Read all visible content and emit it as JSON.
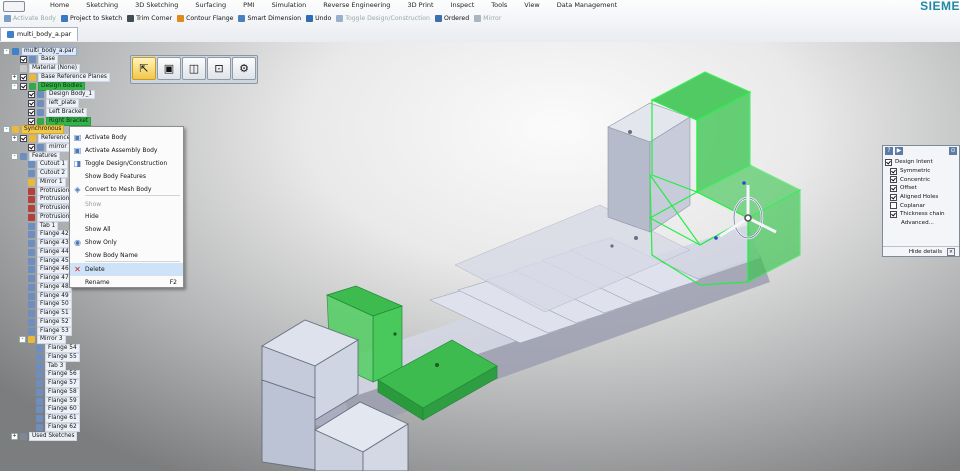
{
  "ribbon": {
    "menu": [
      "Home",
      "Sketching",
      "3D Sketching",
      "Surfacing",
      "PMI",
      "Simulation",
      "Reverse Engineering",
      "3D Print",
      "Inspect",
      "Tools",
      "View",
      "Data Management"
    ],
    "brand": "SIEME",
    "commands": [
      {
        "label": "Activate Body",
        "icon": "activate-icon",
        "dim": true,
        "color": "#7a9cc8"
      },
      {
        "label": "Project to Sketch",
        "icon": "project-icon",
        "dim": false,
        "color": "#3b78c2"
      },
      {
        "label": "Trim Corner",
        "icon": "trim-icon",
        "dim": false,
        "color": "#444b55"
      },
      {
        "label": "Contour Flange",
        "icon": "flange-icon",
        "dim": false,
        "color": "#e08a1e"
      },
      {
        "label": "Smart Dimension",
        "icon": "dimension-icon",
        "dim": false,
        "color": "#4a7fc1"
      },
      {
        "label": "Undo",
        "icon": "undo-icon",
        "dim": false,
        "color": "#2f6cb5"
      },
      {
        "label": "Toggle Design/Construction",
        "icon": "toggle-icon",
        "dim": true,
        "color": "#9ab0cf"
      },
      {
        "label": "Ordered",
        "icon": "ordered-icon",
        "dim": false,
        "color": "#3d6fb0"
      },
      {
        "label": "Mirror",
        "icon": "mirror-icon",
        "dim": true,
        "color": "#aab5c4"
      }
    ],
    "doc_tab": "multi_body_a.par"
  },
  "tree": [
    {
      "label": "multi_body_a.par",
      "d": 0,
      "exp": "-",
      "cb": false,
      "icon": "#3e83c9",
      "style": "blue"
    },
    {
      "label": "Base",
      "d": 1,
      "exp": "",
      "cb": true,
      "icon": "#6d8fbf",
      "style": ""
    },
    {
      "label": "Material (None)",
      "d": 1,
      "exp": "",
      "cb": false,
      "icon": "#c7c7c7",
      "style": ""
    },
    {
      "label": "Base Reference Planes",
      "d": 1,
      "exp": "+",
      "cb": true,
      "icon": "#e8b93b",
      "style": ""
    },
    {
      "label": "Design Bodies",
      "d": 1,
      "exp": "-",
      "cb": true,
      "icon": "#36a84a",
      "style": "sel"
    },
    {
      "label": "Design Body_1",
      "d": 2,
      "exp": "",
      "cb": true,
      "icon": "#6f8ec0",
      "style": ""
    },
    {
      "label": "left_plate",
      "d": 2,
      "exp": "",
      "cb": true,
      "icon": "#6f8ec0",
      "style": ""
    },
    {
      "label": "Left Bracket",
      "d": 2,
      "exp": "",
      "cb": true,
      "icon": "#6f8ec0",
      "style": ""
    },
    {
      "label": "Right Bracket",
      "d": 2,
      "exp": "",
      "cb": true,
      "icon": "#36a84a",
      "style": "sel"
    },
    {
      "label": "Synchronous",
      "d": 0,
      "exp": "-",
      "cb": false,
      "icon": "#e8b93b",
      "style": "hl"
    },
    {
      "label": "Reference Planes",
      "d": 1,
      "exp": "+",
      "cb": true,
      "icon": "#e8b93b",
      "style": ""
    },
    {
      "label": "mirror",
      "d": 2,
      "exp": "",
      "cb": true,
      "icon": "#6f8ec0",
      "style": ""
    },
    {
      "label": "Features",
      "d": 1,
      "exp": "-",
      "cb": false,
      "icon": "#6f8ec0",
      "style": ""
    },
    {
      "label": "Cutout 1",
      "d": 2,
      "exp": "",
      "cb": false,
      "icon": "#6f8ec0",
      "style": ""
    },
    {
      "label": "Cutout 2",
      "d": 2,
      "exp": "",
      "cb": false,
      "icon": "#6f8ec0",
      "style": ""
    },
    {
      "label": "Mirror 1",
      "d": 2,
      "exp": "",
      "cb": false,
      "icon": "#e8b93b",
      "style": ""
    },
    {
      "label": "Protrusion 1",
      "d": 2,
      "exp": "",
      "cb": false,
      "icon": "#b0423a",
      "style": ""
    },
    {
      "label": "Protrusion 2",
      "d": 2,
      "exp": "",
      "cb": false,
      "icon": "#b0423a",
      "style": ""
    },
    {
      "label": "Protrusion 3",
      "d": 2,
      "exp": "",
      "cb": false,
      "icon": "#b0423a",
      "style": ""
    },
    {
      "label": "Protrusion 4",
      "d": 2,
      "exp": "",
      "cb": false,
      "icon": "#b0423a",
      "style": ""
    },
    {
      "label": "Tab 1",
      "d": 2,
      "exp": "",
      "cb": false,
      "icon": "#6f8ec0",
      "style": ""
    },
    {
      "label": "Flange 42",
      "d": 2,
      "exp": "",
      "cb": false,
      "icon": "#6f8ec0",
      "style": ""
    },
    {
      "label": "Flange 43",
      "d": 2,
      "exp": "",
      "cb": false,
      "icon": "#6f8ec0",
      "style": ""
    },
    {
      "label": "Flange 44",
      "d": 2,
      "exp": "",
      "cb": false,
      "icon": "#6f8ec0",
      "style": ""
    },
    {
      "label": "Flange 45",
      "d": 2,
      "exp": "",
      "cb": false,
      "icon": "#6f8ec0",
      "style": ""
    },
    {
      "label": "Flange 46",
      "d": 2,
      "exp": "",
      "cb": false,
      "icon": "#6f8ec0",
      "style": ""
    },
    {
      "label": "Flange 47",
      "d": 2,
      "exp": "",
      "cb": false,
      "icon": "#6f8ec0",
      "style": ""
    },
    {
      "label": "Flange 48",
      "d": 2,
      "exp": "",
      "cb": false,
      "icon": "#6f8ec0",
      "style": ""
    },
    {
      "label": "Flange 49",
      "d": 2,
      "exp": "",
      "cb": false,
      "icon": "#6f8ec0",
      "style": ""
    },
    {
      "label": "Flange 50",
      "d": 2,
      "exp": "",
      "cb": false,
      "icon": "#6f8ec0",
      "style": ""
    },
    {
      "label": "Flange 51",
      "d": 2,
      "exp": "",
      "cb": false,
      "icon": "#6f8ec0",
      "style": ""
    },
    {
      "label": "Flange 52",
      "d": 2,
      "exp": "",
      "cb": false,
      "icon": "#6f8ec0",
      "style": ""
    },
    {
      "label": "Flange 53",
      "d": 2,
      "exp": "",
      "cb": false,
      "icon": "#6f8ec0",
      "style": ""
    },
    {
      "label": "Mirror 3",
      "d": 2,
      "exp": "-",
      "cb": false,
      "icon": "#e8b93b",
      "style": ""
    },
    {
      "label": "Flange 54",
      "d": 3,
      "exp": "",
      "cb": false,
      "icon": "#6f8ec0",
      "style": ""
    },
    {
      "label": "Flange 55",
      "d": 3,
      "exp": "",
      "cb": false,
      "icon": "#6f8ec0",
      "style": ""
    },
    {
      "label": "Tab 3",
      "d": 3,
      "exp": "",
      "cb": false,
      "icon": "#6f8ec0",
      "style": ""
    },
    {
      "label": "Flange 56",
      "d": 3,
      "exp": "",
      "cb": false,
      "icon": "#6f8ec0",
      "style": ""
    },
    {
      "label": "Flange 57",
      "d": 3,
      "exp": "",
      "cb": false,
      "icon": "#6f8ec0",
      "style": ""
    },
    {
      "label": "Flange 58",
      "d": 3,
      "exp": "",
      "cb": false,
      "icon": "#6f8ec0",
      "style": ""
    },
    {
      "label": "Flange 59",
      "d": 3,
      "exp": "",
      "cb": false,
      "icon": "#6f8ec0",
      "style": ""
    },
    {
      "label": "Flange 60",
      "d": 3,
      "exp": "",
      "cb": false,
      "icon": "#6f8ec0",
      "style": ""
    },
    {
      "label": "Flange 61",
      "d": 3,
      "exp": "",
      "cb": false,
      "icon": "#6f8ec0",
      "style": ""
    },
    {
      "label": "Flange 62",
      "d": 3,
      "exp": "",
      "cb": false,
      "icon": "#6f8ec0",
      "style": ""
    },
    {
      "label": "Used Sketches",
      "d": 1,
      "exp": "+",
      "cb": false,
      "icon": "#7d8796",
      "style": ""
    }
  ],
  "context_menu": [
    {
      "label": "Activate Body",
      "icon": "activate-body-icon",
      "glyph": "▣",
      "color": "#4a78b8",
      "state": "normal"
    },
    {
      "label": "Activate Assembly Body",
      "icon": "assembly-body-icon",
      "glyph": "▣",
      "color": "#4a78b8",
      "state": "normal"
    },
    {
      "label": "Toggle Design/Construction",
      "icon": "toggle-design-icon",
      "glyph": "◨",
      "color": "#4a78b8",
      "state": "normal"
    },
    {
      "label": "Show Body Features",
      "icon": "",
      "glyph": "",
      "color": "",
      "state": "normal"
    },
    {
      "label": "Convert to Mesh Body",
      "icon": "mesh-icon",
      "glyph": "◈",
      "color": "#4a78b8",
      "state": "normal"
    },
    {
      "label": "Show",
      "icon": "",
      "glyph": "",
      "color": "",
      "state": "dis"
    },
    {
      "label": "Hide",
      "icon": "",
      "glyph": "",
      "color": "",
      "state": "normal"
    },
    {
      "label": "Show All",
      "icon": "",
      "glyph": "",
      "color": "",
      "state": "normal"
    },
    {
      "label": "Show Only",
      "icon": "show-only-icon",
      "glyph": "◉",
      "color": "#4a78b8",
      "state": "normal"
    },
    {
      "label": "Show Body Name",
      "icon": "",
      "glyph": "",
      "color": "",
      "state": "normal"
    },
    {
      "label": "Delete",
      "icon": "delete-icon",
      "glyph": "✕",
      "color": "#d02020",
      "state": "hot",
      "shortcut": ""
    },
    {
      "label": "Rename",
      "icon": "",
      "glyph": "",
      "color": "",
      "state": "normal",
      "shortcut": "F2"
    }
  ],
  "design_intent": {
    "title": "Design Intent",
    "items": [
      {
        "label": "Symmetric",
        "checked": true
      },
      {
        "label": "Concentric",
        "checked": true
      },
      {
        "label": "Offset",
        "checked": true
      },
      {
        "label": "Aligned Holes",
        "checked": true
      },
      {
        "label": "Coplanar",
        "checked": false
      },
      {
        "label": "Thickness chain",
        "checked": true
      }
    ],
    "advanced": "Advanced...",
    "footer": "Hide details"
  },
  "colors": {
    "selection_green": "#36c24a",
    "body": "#cfd4e2",
    "accent": "#1f8aa5"
  }
}
